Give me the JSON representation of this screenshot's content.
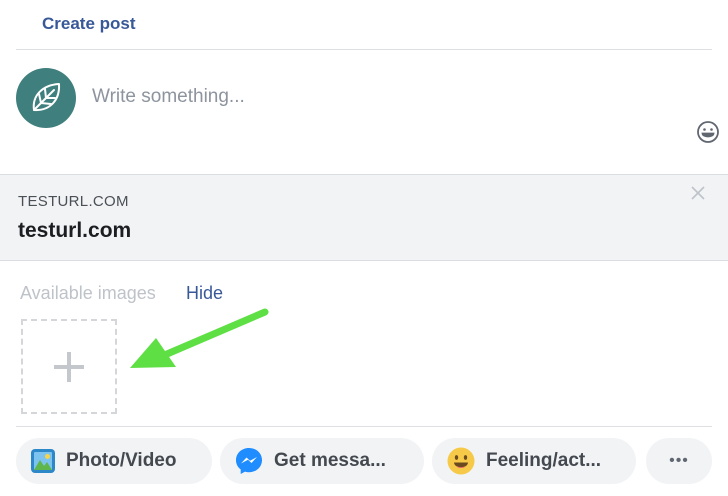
{
  "header": {
    "title": "Create post"
  },
  "composer": {
    "placeholder": "Write something..."
  },
  "link_preview": {
    "domain": "TESTURL.COM",
    "title": "testurl.com"
  },
  "images": {
    "label": "Available images",
    "hide_label": "Hide"
  },
  "actions": [
    {
      "label": "Photo/Video",
      "icon": "photo-icon"
    },
    {
      "label": "Get messa...",
      "icon": "messenger-icon"
    },
    {
      "label": "Feeling/act...",
      "icon": "smiley-icon"
    },
    {
      "label": "•••",
      "icon": "more-icon"
    }
  ],
  "colors": {
    "brand_blue": "#385898",
    "avatar_teal": "#3f7f7d",
    "arrow_green": "#5ee044",
    "pill_bg": "#f2f3f5",
    "preview_bg": "#f2f3f5"
  }
}
